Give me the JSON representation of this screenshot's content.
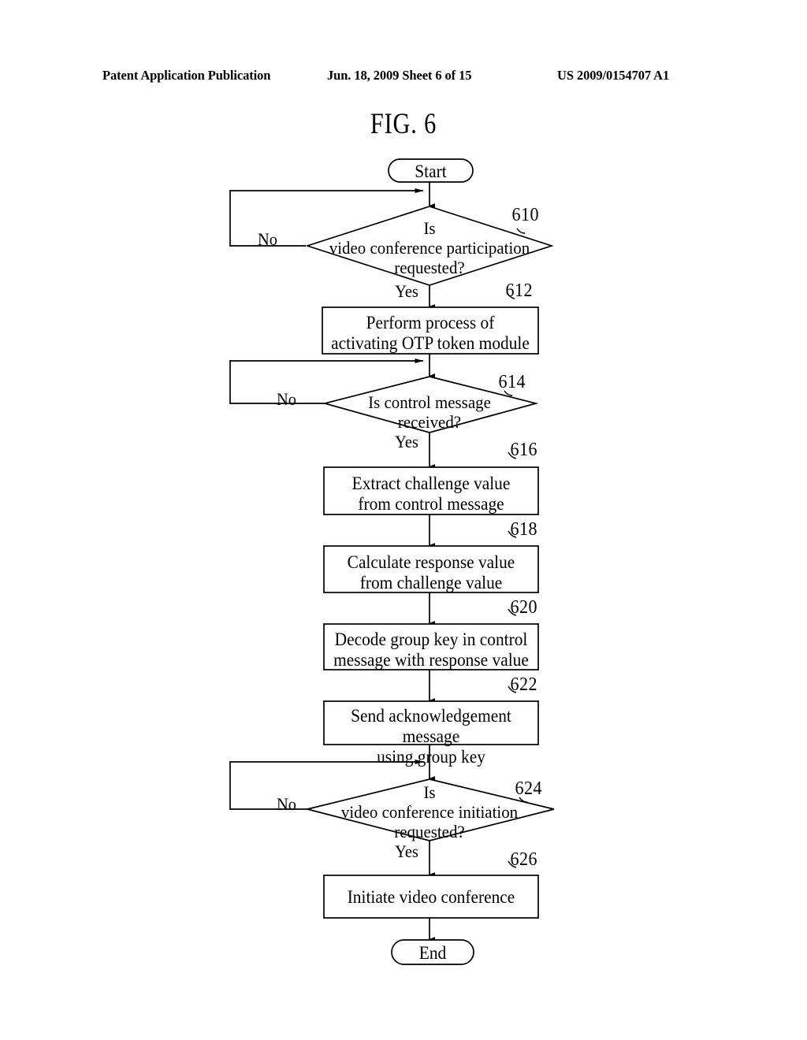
{
  "header": {
    "publication": "Patent Application Publication",
    "date_sheet": "Jun. 18, 2009  Sheet 6 of 15",
    "patent_number": "US 2009/0154707 A1"
  },
  "figure": {
    "title": "FIG. 6"
  },
  "flowchart": {
    "start_label": "Start",
    "end_label": "End",
    "yes_label": "Yes",
    "no_label": "No",
    "nodes": [
      {
        "id": "start",
        "type": "terminator",
        "text": "Start",
        "ref": ""
      },
      {
        "id": "d610",
        "type": "decision",
        "text": "Is\nvideo conference participation\nrequested?",
        "ref": "610"
      },
      {
        "id": "p612",
        "type": "process",
        "text": "Perform process of\nactivating OTP token module",
        "ref": "612"
      },
      {
        "id": "d614",
        "type": "decision",
        "text": "Is control message\nreceived?",
        "ref": "614"
      },
      {
        "id": "p616",
        "type": "process",
        "text": "Extract challenge value\nfrom control message",
        "ref": "616"
      },
      {
        "id": "p618",
        "type": "process",
        "text": "Calculate response value\nfrom challenge value",
        "ref": "618"
      },
      {
        "id": "p620",
        "type": "process",
        "text": "Decode group key in control\nmessage with response value",
        "ref": "620"
      },
      {
        "id": "p622",
        "type": "process",
        "text": "Send acknowledgement message\nusing group key",
        "ref": "622"
      },
      {
        "id": "d624",
        "type": "decision",
        "text": "Is\nvideo conference initiation\nrequested?",
        "ref": "624"
      },
      {
        "id": "p626",
        "type": "process",
        "text": "Initiate video conference",
        "ref": "626"
      },
      {
        "id": "end",
        "type": "terminator",
        "text": "End",
        "ref": ""
      }
    ],
    "edges": [
      {
        "from": "d610",
        "to": "d610",
        "label": "No"
      },
      {
        "from": "d610",
        "to": "p612",
        "label": "Yes"
      },
      {
        "from": "d614",
        "to": "d614",
        "label": "No"
      },
      {
        "from": "d614",
        "to": "p616",
        "label": "Yes"
      },
      {
        "from": "d624",
        "to": "d624",
        "label": "No"
      },
      {
        "from": "d624",
        "to": "p626",
        "label": "Yes"
      }
    ]
  },
  "colors": {
    "ink": "#000000",
    "paper": "#ffffff"
  }
}
